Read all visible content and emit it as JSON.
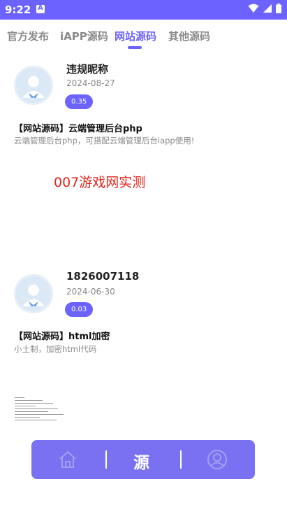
{
  "status_bar": {
    "time": "9:22"
  },
  "tabs": [
    {
      "label": "官方发布",
      "active": false
    },
    {
      "label": "iAPP源码",
      "active": false
    },
    {
      "label": "网站源码",
      "active": true
    },
    {
      "label": "其他源码",
      "active": false
    }
  ],
  "posts": [
    {
      "username": "违规昵称",
      "date": "2024-08-27",
      "badge": "0.35",
      "title": "【网站源码】云端管理后台php",
      "description": "云端管理后台php，可搭配云端管理后台iapp使用!",
      "promo_text": "007游戏网实测"
    },
    {
      "username": "1826007118",
      "date": "2024-06-30",
      "badge": "0.03",
      "title": "【网站源码】html加密",
      "description": "小土制，加密html代码"
    }
  ],
  "bottom_nav": {
    "center_label": "源"
  },
  "colors": {
    "accent": "#6c63ff",
    "promo": "#e0261c"
  }
}
